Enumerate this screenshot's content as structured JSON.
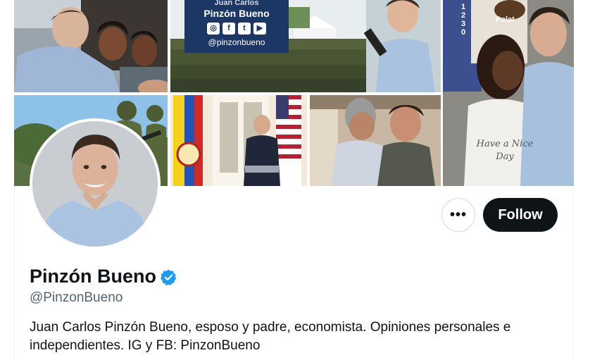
{
  "banner": {
    "overlay": {
      "top_text": "Juan Carlos",
      "name": "Pinzón Bueno",
      "icons": [
        {
          "name": "instagram-icon",
          "glyph": "◎"
        },
        {
          "name": "facebook-icon",
          "glyph": "f"
        },
        {
          "name": "twitter-icon",
          "glyph": "t"
        },
        {
          "name": "youtube-icon",
          "glyph": "▶"
        }
      ],
      "handle": "@pinzonbueno"
    },
    "sign_number": "1230",
    "sign_brand": "Polet",
    "shirt_text": "Have a Nice Day",
    "colors": {
      "overlay_bg": "#1c3763"
    }
  },
  "profile": {
    "display_name": "Pinzón Bueno",
    "verified": true,
    "username": "@PinzonBueno",
    "bio": "Juan Carlos Pinzón Bueno, esposo y padre, economista. Opiniones personales e independientes. IG y FB: PinzonBueno"
  },
  "actions": {
    "more_label": "•••",
    "follow_label": "Follow"
  },
  "colors": {
    "follow_bg": "#0f1419",
    "verified_blue": "#1d9bf0",
    "secondary_text": "#536471"
  }
}
